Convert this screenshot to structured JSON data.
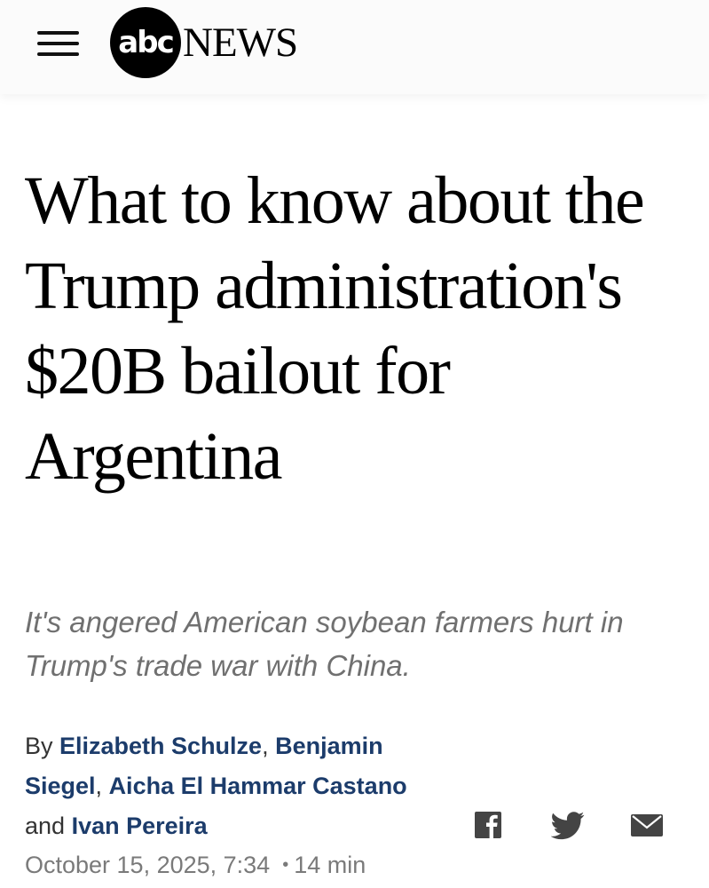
{
  "header": {
    "menu_icon": "hamburger-menu-icon",
    "logo_abc": "abc",
    "logo_news": "NEWS"
  },
  "article": {
    "headline": "What to know about the Trump administration's $20B bailout for Argentina",
    "subhead": "It's angered American soybean farmers hurt in Trump's trade war with China.",
    "byline": {
      "by": "By ",
      "authors": [
        "Elizabeth Schulze",
        "Benjamin Siegel",
        "Aicha El Hammar Castano",
        "Ivan Pereira"
      ],
      "sep1": ", ",
      "sep2": ", ",
      "and": " and "
    },
    "date": "October 15, 2025, 7:34",
    "dot": "•",
    "read_time": "14 min"
  },
  "share": {
    "facebook_icon": "facebook-icon",
    "twitter_icon": "twitter-icon",
    "email_icon": "email-icon",
    "icon_color": "#444444"
  },
  "colors": {
    "author_link": "#1c3c6b",
    "subhead": "#707070",
    "meta": "#7a7a7a"
  }
}
